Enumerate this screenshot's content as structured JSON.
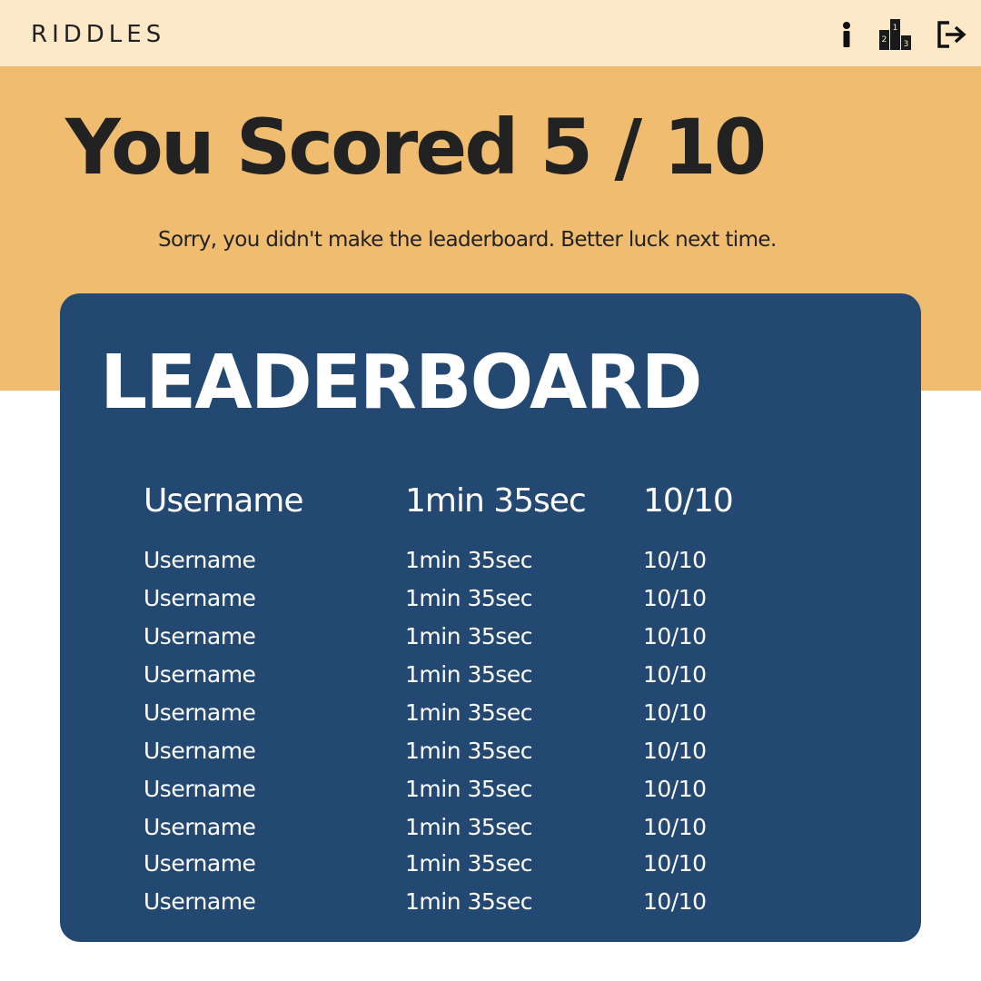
{
  "header": {
    "brand": "RIDDLES",
    "icons": [
      "info-icon",
      "podium-icon",
      "exit-icon"
    ]
  },
  "result": {
    "title": "You Scored 5 / 10",
    "message": "Sorry, you didn't make the leaderboard. Better luck next time."
  },
  "leaderboard": {
    "title": "LEADERBOARD",
    "header_row": {
      "username": "Username",
      "time": "1min 35sec",
      "score": "10/10"
    },
    "rows": [
      {
        "username": "Username",
        "time": "1min 35sec",
        "score": "10/10"
      },
      {
        "username": "Username",
        "time": "1min 35sec",
        "score": "10/10"
      },
      {
        "username": "Username",
        "time": "1min 35sec",
        "score": "10/10"
      },
      {
        "username": "Username",
        "time": "1min 35sec",
        "score": "10/10"
      },
      {
        "username": "Username",
        "time": "1min 35sec",
        "score": "10/10"
      },
      {
        "username": "Username",
        "time": "1min 35sec",
        "score": "10/10"
      },
      {
        "username": "Username",
        "time": "1min 35sec",
        "score": "10/10"
      },
      {
        "username": "Username",
        "time": "1min 35sec",
        "score": "10/10"
      },
      {
        "username": "Username",
        "time": "1min 35sec",
        "score": "10/10"
      },
      {
        "username": "Username",
        "time": "1min 35sec",
        "score": "10/10"
      }
    ]
  },
  "colors": {
    "topbar": "#fde9c7",
    "hero": "#f0bd70",
    "board": "#234872",
    "text_dark": "#222222",
    "text_light": "#ffffff"
  }
}
